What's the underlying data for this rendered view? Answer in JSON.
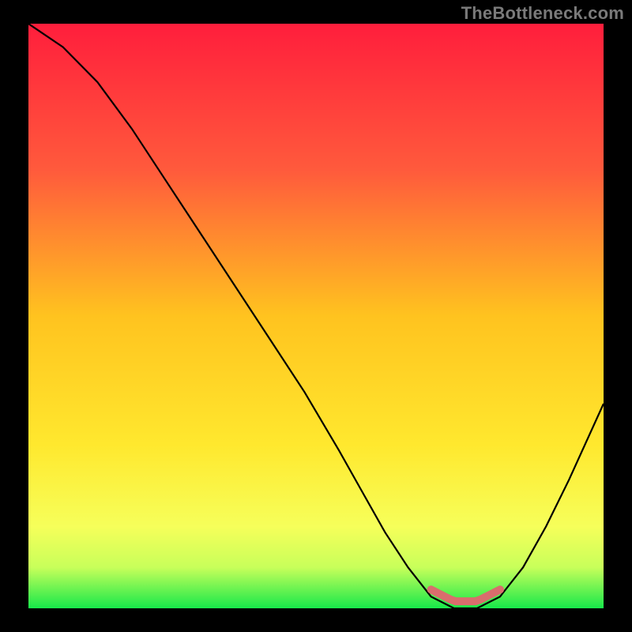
{
  "watermark": "TheBottleneck.com",
  "chart_data": {
    "type": "line",
    "title": "",
    "xlabel": "",
    "ylabel": "",
    "xlim": [
      0,
      100
    ],
    "ylim": [
      0,
      100
    ],
    "series": [
      {
        "name": "bottleneck-curve",
        "x": [
          0,
          6,
          12,
          18,
          24,
          30,
          36,
          42,
          48,
          54,
          58,
          62,
          66,
          70,
          74,
          78,
          82,
          86,
          90,
          94,
          100
        ],
        "values": [
          100,
          96,
          90,
          82,
          73,
          64,
          55,
          46,
          37,
          27,
          20,
          13,
          7,
          2,
          0,
          0,
          2,
          7,
          14,
          22,
          35
        ]
      }
    ],
    "annotations": [
      {
        "name": "optimal-range",
        "x_start": 70,
        "x_end": 82,
        "y": 1
      }
    ],
    "background_gradient": {
      "stops": [
        {
          "offset": 0.0,
          "color": "#ff1e3c"
        },
        {
          "offset": 0.25,
          "color": "#ff5a3c"
        },
        {
          "offset": 0.5,
          "color": "#ffc31f"
        },
        {
          "offset": 0.72,
          "color": "#ffe82e"
        },
        {
          "offset": 0.86,
          "color": "#f6ff5a"
        },
        {
          "offset": 0.93,
          "color": "#c8ff5a"
        },
        {
          "offset": 1.0,
          "color": "#17e84a"
        }
      ]
    },
    "colors": {
      "curve": "#000000",
      "optimal_marker": "#d96d6d"
    }
  }
}
